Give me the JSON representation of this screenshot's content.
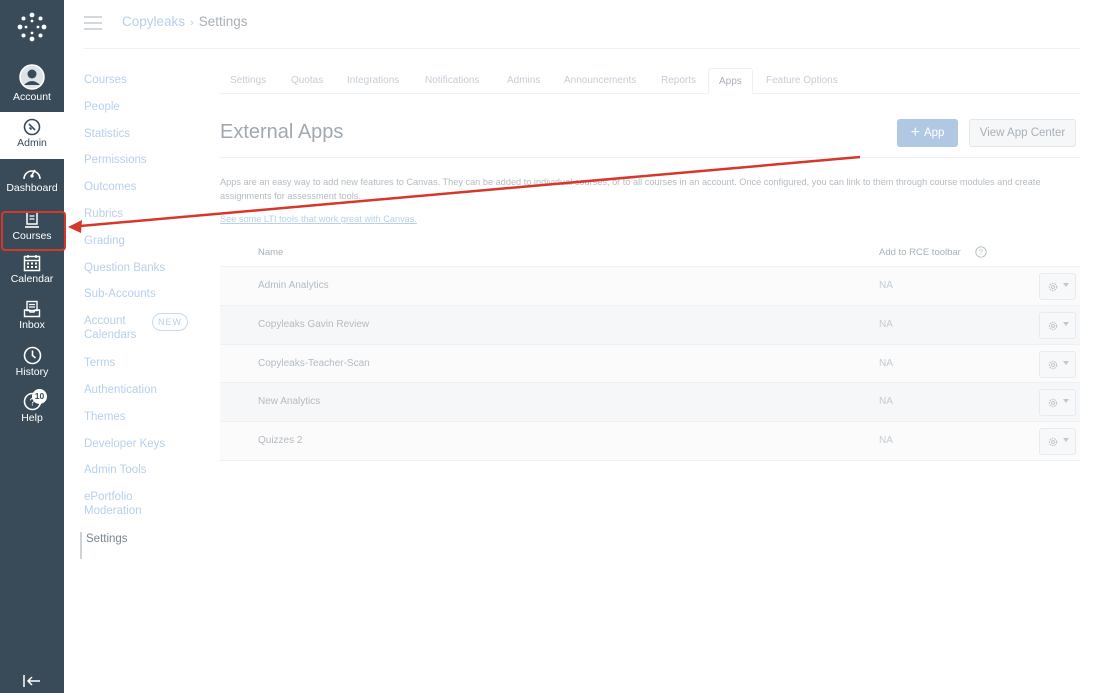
{
  "global_nav": {
    "account": "Account",
    "admin": "Admin",
    "dashboard": "Dashboard",
    "courses": "Courses",
    "calendar": "Calendar",
    "inbox": "Inbox",
    "history": "History",
    "help": "Help",
    "help_badge": "10"
  },
  "breadcrumb": {
    "account": "Copyleaks",
    "separator": "›",
    "current": "Settings"
  },
  "subnav": {
    "items": [
      "Courses",
      "People",
      "Statistics",
      "Permissions",
      "Outcomes",
      "Rubrics",
      "Grading",
      "Question Banks",
      "Sub-Accounts",
      "Account Calendars",
      "Terms",
      "Authentication",
      "Themes",
      "Developer Keys",
      "Admin Tools",
      "ePortfolio Moderation",
      "Settings"
    ],
    "new_badge": "NEW"
  },
  "tabs": [
    "Settings",
    "Quotas",
    "Integrations",
    "Notifications",
    "Admins",
    "Announcements",
    "Reports",
    "Apps",
    "Feature Options"
  ],
  "page": {
    "title": "External Apps",
    "add_app_label": "App",
    "view_center_label": "View App Center",
    "description": "Apps are an easy way to add new features to Canvas. They can be added to individual courses, or to all courses in an account. Once configured, you can link to them through course modules and create assignments for assessment tools.",
    "lti_link": "See some LTI tools that work great with Canvas."
  },
  "table": {
    "col_name": "Name",
    "col_rce": "Add to RCE toolbar",
    "rows": [
      {
        "name": "Admin Analytics",
        "rce": "NA"
      },
      {
        "name": "Copyleaks Gavin Review",
        "rce": "NA"
      },
      {
        "name": "Copyleaks-Teacher-Scan",
        "rce": "NA"
      },
      {
        "name": "New Analytics",
        "rce": "NA"
      },
      {
        "name": "Quizzes 2",
        "rce": "NA"
      }
    ]
  },
  "colors": {
    "nav_bg": "#394b58",
    "annotation": "#d6372b",
    "link": "#b7d0ec"
  }
}
